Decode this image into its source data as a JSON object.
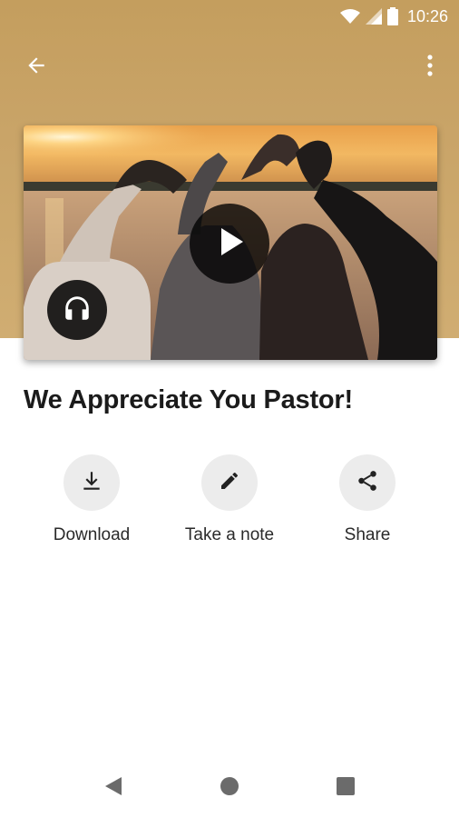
{
  "status_bar": {
    "time": "10:26",
    "icons": [
      "wifi-icon",
      "signal-icon",
      "battery-icon"
    ]
  },
  "app_bar": {
    "icons": [
      "back-arrow-icon",
      "more-vert-icon"
    ]
  },
  "media": {
    "icons": [
      "play-icon",
      "headphones-icon"
    ]
  },
  "content": {
    "title": "We Appreciate You Pastor!"
  },
  "actions": [
    {
      "label": "Download",
      "icon": "download-icon"
    },
    {
      "label": "Take a note",
      "icon": "pencil-icon"
    },
    {
      "label": "Share",
      "icon": "share-icon"
    }
  ],
  "nav_bar": {
    "icons": [
      "nav-back-icon",
      "nav-home-icon",
      "nav-recents-icon"
    ]
  },
  "colors": {
    "header": "#c9a468",
    "icon_circle": "#ececec",
    "text": "#1b1b1b"
  }
}
